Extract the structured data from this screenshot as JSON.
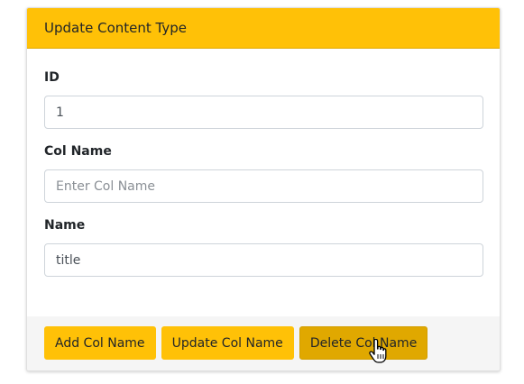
{
  "header": {
    "title": "Update Content Type"
  },
  "form": {
    "id": {
      "label": "ID",
      "value": "1",
      "placeholder": ""
    },
    "col_name": {
      "label": "Col Name",
      "value": "",
      "placeholder": "Enter Col Name"
    },
    "name": {
      "label": "Name",
      "value": "title",
      "placeholder": ""
    }
  },
  "footer": {
    "add_label": "Add Col Name",
    "update_label": "Update Col Name",
    "delete_label": "Delete Col Name"
  },
  "colors": {
    "accent": "#ffc107",
    "accent_active": "#e0a800",
    "footer_bg": "#f5f5f5"
  },
  "cursor": {
    "icon": "hand-pointer-icon"
  }
}
